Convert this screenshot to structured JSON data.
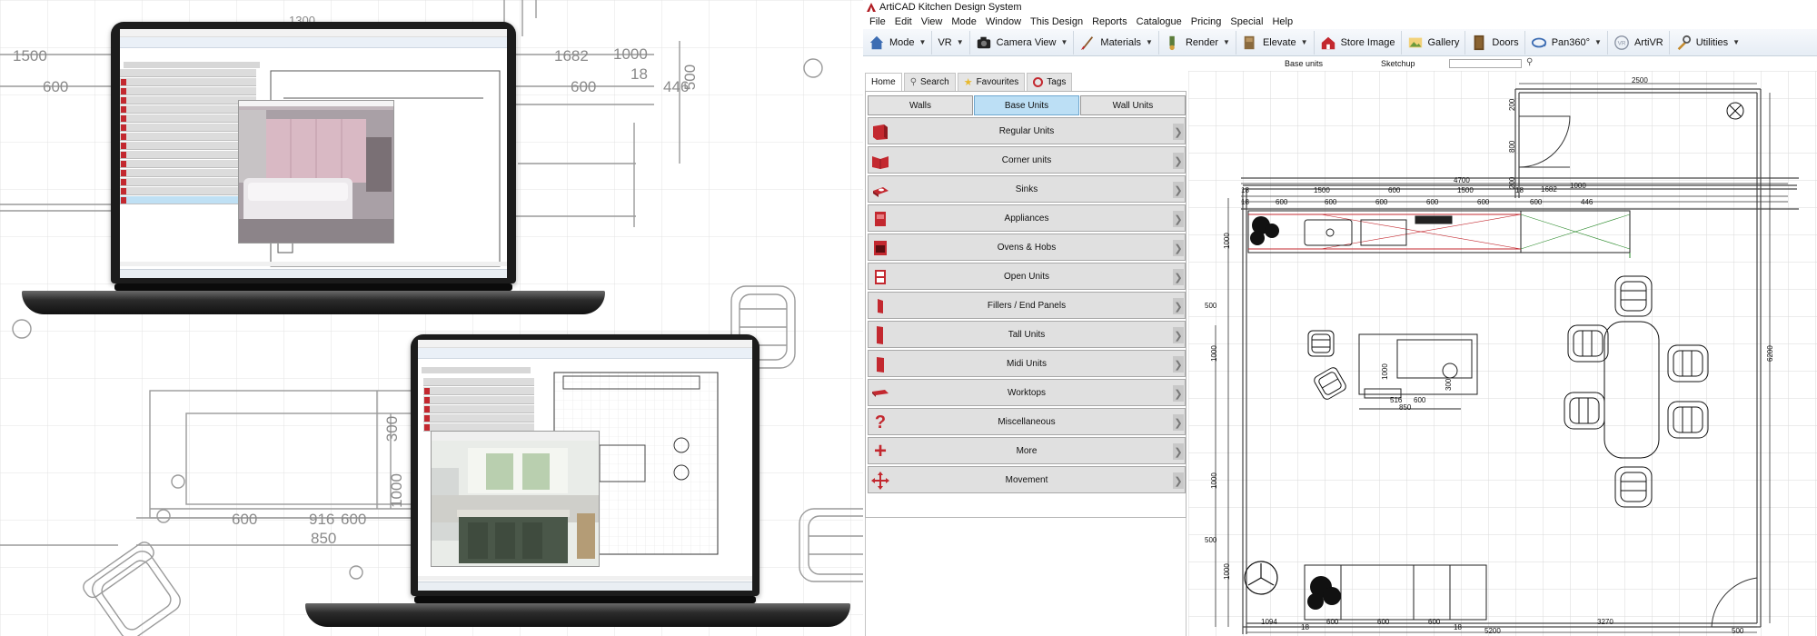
{
  "background": {
    "dimensions": [
      "1500",
      "600",
      "1682",
      "1000",
      "18",
      "600",
      "446",
      "500",
      "1300",
      "300",
      "1000",
      "600",
      "916",
      "600",
      "850"
    ]
  },
  "app": {
    "title": "ArtiCAD Kitchen Design System",
    "menu": [
      "File",
      "Edit",
      "View",
      "Mode",
      "Window",
      "This Design",
      "Reports",
      "Catalogue",
      "Pricing",
      "Special",
      "Help"
    ],
    "toolbar": [
      {
        "label": "Mode",
        "icon": "house-icon",
        "dropdown": true
      },
      {
        "label": "VR",
        "icon": "",
        "dropdown": true
      },
      {
        "label": "Camera View",
        "icon": "camera-icon",
        "dropdown": true
      },
      {
        "label": "Materials",
        "icon": "paintbrush-icon",
        "dropdown": true
      },
      {
        "label": "Render",
        "icon": "render-icon",
        "dropdown": true
      },
      {
        "label": "Elevate",
        "icon": "elevate-icon",
        "dropdown": true
      },
      {
        "label": "Store Image",
        "icon": "store-image-icon",
        "dropdown": false
      },
      {
        "label": "Gallery",
        "icon": "gallery-icon",
        "dropdown": false
      },
      {
        "label": "Doors",
        "icon": "door-icon",
        "dropdown": false
      },
      {
        "label": "Pan360°",
        "icon": "pan360-icon",
        "dropdown": true
      },
      {
        "label": "ArtiVR",
        "icon": "vr-goggles-icon",
        "dropdown": false
      },
      {
        "label": "Utilities",
        "icon": "tools-icon",
        "dropdown": true
      }
    ],
    "search_row": {
      "label_base_units": "Base units",
      "label_sketchup": "Sketchup",
      "search_value": ""
    },
    "panel_tabs": [
      {
        "label": "Home",
        "icon": "",
        "active": true
      },
      {
        "label": "Search",
        "icon": "magnifier-icon",
        "active": false
      },
      {
        "label": "Favourites",
        "icon": "star-icon",
        "active": false
      },
      {
        "label": "Tags",
        "icon": "tag-icon",
        "active": false
      }
    ],
    "category_tabs": [
      {
        "label": "Walls",
        "active": false
      },
      {
        "label": "Base Units",
        "active": true
      },
      {
        "label": "Wall Units",
        "active": false
      }
    ],
    "categories": [
      {
        "label": "Regular Units",
        "icon": "regular-unit-icon"
      },
      {
        "label": "Corner units",
        "icon": "corner-unit-icon"
      },
      {
        "label": "Sinks",
        "icon": "sink-icon"
      },
      {
        "label": "Appliances",
        "icon": "appliance-icon"
      },
      {
        "label": "Ovens & Hobs",
        "icon": "oven-icon"
      },
      {
        "label": "Open Units",
        "icon": "open-unit-icon"
      },
      {
        "label": "Fillers / End Panels",
        "icon": "filler-icon"
      },
      {
        "label": "Tall Units",
        "icon": "tall-unit-icon"
      },
      {
        "label": "Midi Units",
        "icon": "midi-unit-icon"
      },
      {
        "label": "Worktops",
        "icon": "worktop-icon"
      },
      {
        "label": "Miscellaneous",
        "icon": "question-icon"
      },
      {
        "label": "More",
        "icon": "plus-icon"
      },
      {
        "label": "Movement",
        "icon": "move-arrows-icon"
      }
    ],
    "plan_dimensions": {
      "top_width": "2500",
      "right_height": "6200",
      "run_total": "4700",
      "run_ticks": [
        "18",
        "1500",
        "600",
        "1500",
        "18"
      ],
      "run_segments": [
        "18",
        "600",
        "600",
        "600",
        "600",
        "600",
        "600",
        "446"
      ],
      "run_upper": [
        "1682",
        "1000"
      ],
      "door_left": [
        "200",
        "800",
        "200"
      ],
      "left_side": [
        "1000",
        "500",
        "1000",
        "1000",
        "500",
        "1000"
      ],
      "island": [
        "1000",
        "516",
        "600",
        "850",
        "300"
      ],
      "bottom_segments": [
        "1094",
        "18",
        "600",
        "600",
        "600",
        "18",
        "3270"
      ],
      "bottom_total": "5200",
      "bottom_right": "500"
    }
  }
}
